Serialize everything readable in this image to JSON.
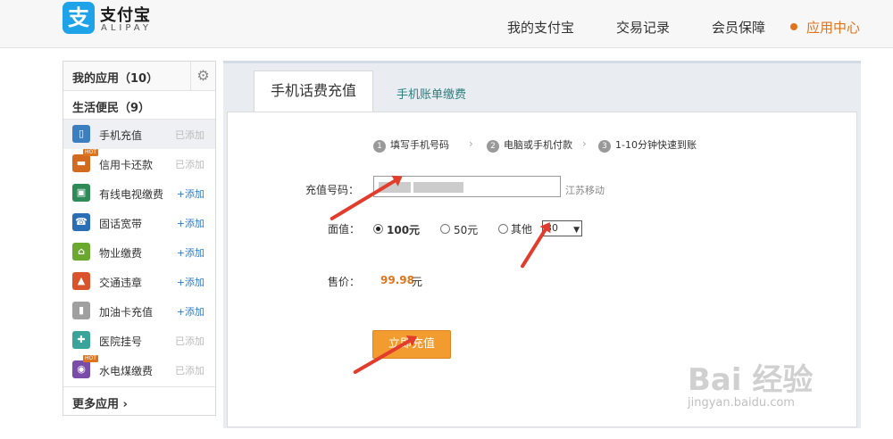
{
  "header": {
    "logo_glyph": "支",
    "logo_text": "支付宝",
    "logo_sub": "ALIPAY",
    "nav": [
      "我的支付宝",
      "交易记录",
      "会员保障",
      "应用中心"
    ]
  },
  "sidebar": {
    "my_apps": "我的应用（10）",
    "category": "生活便民（9）",
    "items": [
      {
        "name": "手机充值",
        "action": "已添加",
        "icon": "phone-icon",
        "color": "#3b7fc0"
      },
      {
        "name": "信用卡还款",
        "action": "已添加",
        "icon": "credit-card-icon",
        "color": "#d26b1f"
      },
      {
        "name": "有线电视缴费",
        "action": "+添加",
        "icon": "tv-icon",
        "color": "#2e8b57"
      },
      {
        "name": "固话宽带",
        "action": "+添加",
        "icon": "landline-icon",
        "color": "#2a6fb5"
      },
      {
        "name": "物业缴费",
        "action": "+添加",
        "icon": "house-icon",
        "color": "#6aa830"
      },
      {
        "name": "交通违章",
        "action": "+添加",
        "icon": "car-icon",
        "color": "#d9542c"
      },
      {
        "name": "加油卡充值",
        "action": "+添加",
        "icon": "fuel-icon",
        "color": "#a0a0a0"
      },
      {
        "name": "医院挂号",
        "action": "已添加",
        "icon": "hospital-icon",
        "color": "#3aa39a"
      },
      {
        "name": "水电煤缴费",
        "action": "已添加",
        "icon": "utility-icon",
        "color": "#7a4ea8"
      }
    ],
    "hot": "HOT",
    "more": "更多应用"
  },
  "main": {
    "tab_active": "手机话费充值",
    "tab_other": "手机账单缴费",
    "steps": [
      "填写手机号码",
      "电脑或手机付款",
      "1-10分钟快速到账"
    ],
    "phone_label": "充值号码：",
    "carrier": "江苏移动",
    "face_label": "面值：",
    "options": [
      "100元",
      "50元",
      "其他"
    ],
    "other_value": "30",
    "price_label": "售价：",
    "price_value": "99.98",
    "price_unit": "元",
    "submit": "立即充值"
  },
  "watermark": {
    "main": "Bai 经验",
    "sub": "jingyan.baidu.com"
  }
}
